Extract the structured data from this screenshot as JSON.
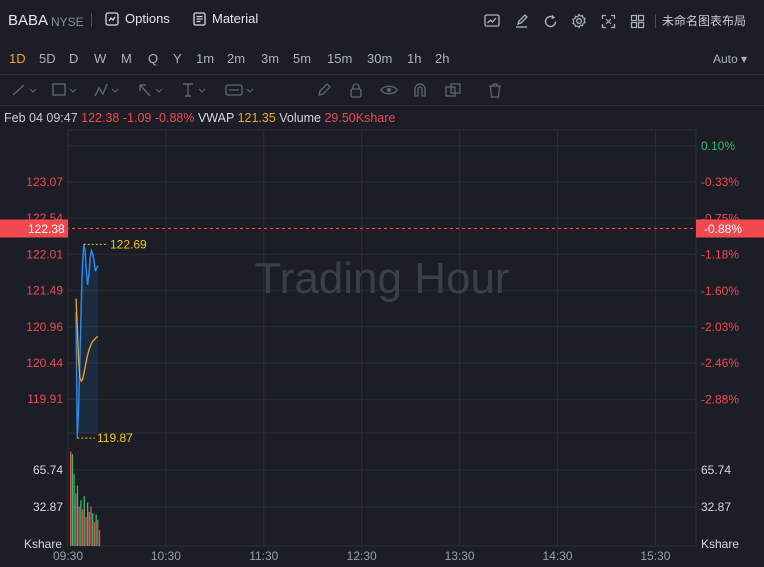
{
  "header": {
    "symbol": "BABA",
    "exchange": "NYSE",
    "options_label": "Options",
    "material_label": "Material",
    "layout_name": "未命名图表布局",
    "icons": [
      "chart-icon",
      "edit-icon",
      "refresh-icon",
      "settings-icon",
      "fullscreen-icon",
      "grid-icon"
    ]
  },
  "periods": [
    "1D",
    "5D",
    "D",
    "W",
    "M",
    "Q",
    "Y",
    "1m",
    "2m",
    "3m",
    "5m",
    "15m",
    "30m",
    "1h",
    "2h"
  ],
  "active_period": "1D",
  "auto_label": "Auto",
  "drawing_tools": [
    "line-tool-icon",
    "rect-tool-icon",
    "pen-tool-icon",
    "arrow-tool-icon",
    "text-tool-icon",
    "label-tool-icon",
    "pencil-icon",
    "lock-icon",
    "eye-icon",
    "magnet-icon",
    "layers-icon",
    "trash-icon"
  ],
  "legend": {
    "datetime": "Feb 04 09:47",
    "price": "122.38",
    "change": "-1.09",
    "change_pct": "-0.88%",
    "vwap_label": "VWAP",
    "vwap_value": "121.35",
    "volume_label": "Volume",
    "volume_value": "29.50Kshare"
  },
  "watermark": "Trading Hour",
  "colors": {
    "up": "#2fbf71",
    "down": "#f0494f",
    "vwap": "#f5a623",
    "price": "#2f8bf0",
    "highlight": "#f5c518"
  },
  "chart_data": {
    "type": "line",
    "price_axis": [
      "123.07",
      "122.54",
      "122.01",
      "121.49",
      "120.96",
      "120.44",
      "119.91"
    ],
    "pct_axis": [
      "0.10%",
      "-0.33%",
      "-0.75%",
      "-1.18%",
      "-1.60%",
      "-2.03%",
      "-2.46%",
      "-2.88%"
    ],
    "time_axis": [
      "09:30",
      "10:30",
      "11:30",
      "12:30",
      "13:30",
      "14:30",
      "15:30"
    ],
    "last_price": "122.38",
    "last_pct": "-0.88%",
    "high_label": "122.69",
    "low_label": "119.87",
    "volume_axis": [
      "65.74",
      "32.87",
      "Kshare"
    ],
    "volume_axis_right": [
      "65.74",
      "32.87",
      "Kshare"
    ],
    "series": [
      {
        "name": "Price",
        "x": [
          0,
          1,
          2,
          3,
          4,
          5,
          6,
          7,
          8,
          9,
          10,
          11,
          12,
          13,
          14,
          15,
          16,
          17
        ],
        "values": [
          121.7,
          119.87,
          120.3,
          121.0,
          121.8,
          122.4,
          122.69,
          122.6,
          122.3,
          122.1,
          122.25,
          122.5,
          122.6,
          122.55,
          122.45,
          122.3,
          122.35,
          122.38
        ]
      },
      {
        "name": "VWAP",
        "x": [
          0,
          1,
          2,
          3,
          4,
          5,
          6,
          7,
          8,
          9,
          10,
          11,
          12,
          13,
          14,
          15,
          16,
          17
        ],
        "values": [
          121.9,
          121.5,
          121.0,
          120.75,
          120.7,
          120.72,
          120.8,
          120.9,
          121.0,
          121.08,
          121.15,
          121.2,
          121.25,
          121.28,
          121.3,
          121.32,
          121.34,
          121.35
        ]
      }
    ],
    "volume": [
      {
        "v": 72,
        "up": false
      },
      {
        "v": 70,
        "up": true
      },
      {
        "v": 55,
        "up": true
      },
      {
        "v": 40,
        "up": false
      },
      {
        "v": 46,
        "up": true
      },
      {
        "v": 30,
        "up": false
      },
      {
        "v": 35,
        "up": true
      },
      {
        "v": 28,
        "up": false
      },
      {
        "v": 38,
        "up": true
      },
      {
        "v": 22,
        "up": false
      },
      {
        "v": 33,
        "up": true
      },
      {
        "v": 26,
        "up": false
      },
      {
        "v": 30,
        "up": false
      },
      {
        "v": 25,
        "up": true
      },
      {
        "v": 18,
        "up": false
      },
      {
        "v": 24,
        "up": true
      },
      {
        "v": 20,
        "up": false
      },
      {
        "v": 12,
        "up": false
      }
    ],
    "y_range": [
      119.5,
      123.4
    ],
    "volume_max": 80
  }
}
